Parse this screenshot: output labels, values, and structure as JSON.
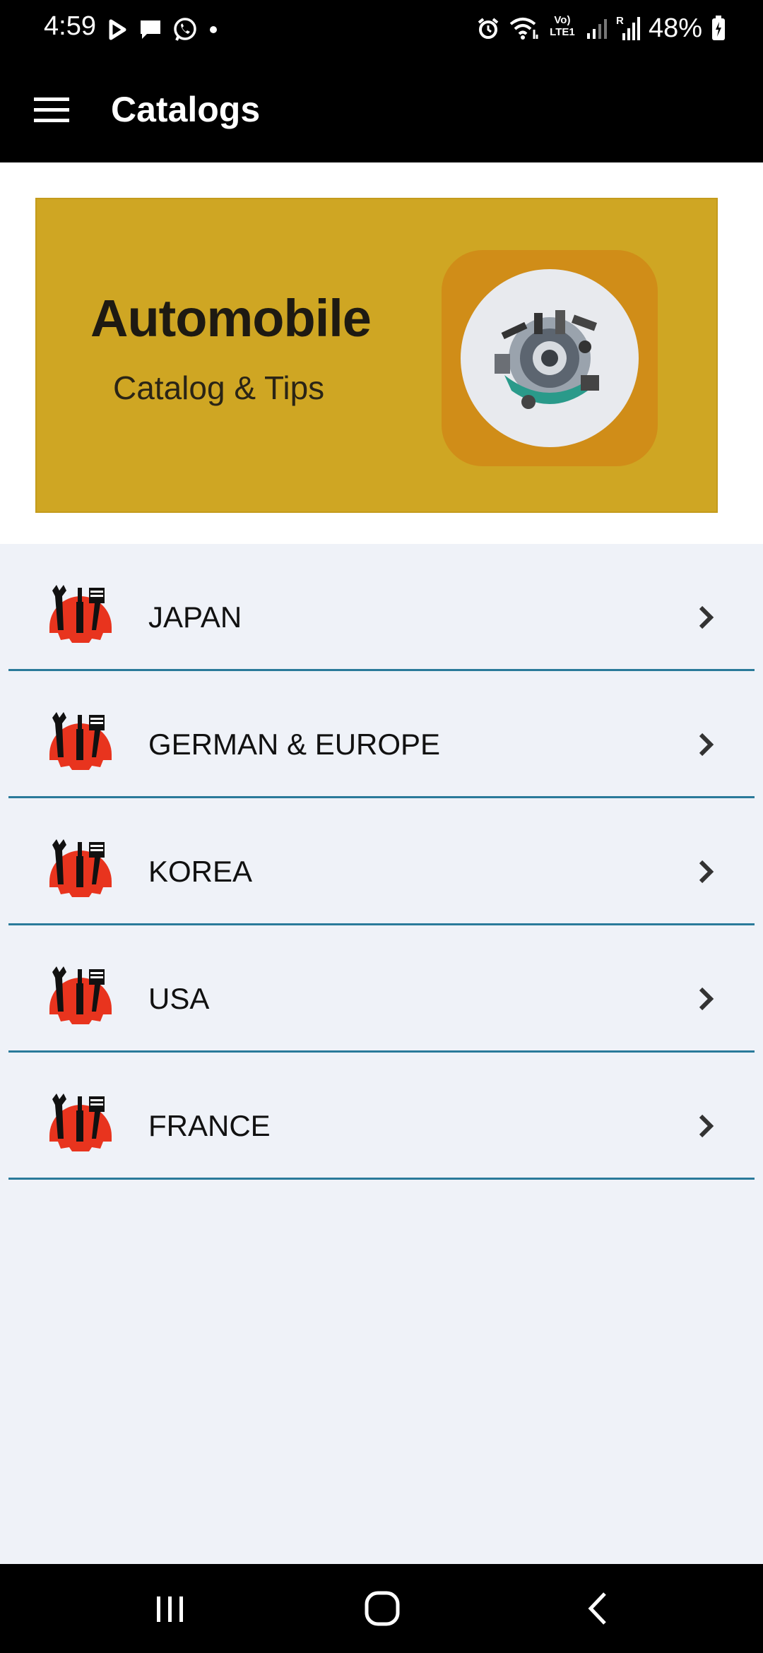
{
  "status_bar": {
    "time": "4:59",
    "battery": "48%",
    "left_icons": [
      "play-icon",
      "message-icon",
      "whatsapp-icon",
      "dot-icon"
    ],
    "right_icons": [
      "alarm-icon",
      "wifi-icon",
      "volte-icon",
      "signal-icon",
      "roaming-signal-icon",
      "battery-charging-icon"
    ],
    "volte_label": "Vo) LTE1",
    "roaming_label": "R"
  },
  "app_bar": {
    "title": "Catalogs",
    "menu_icon": "hamburger-menu-icon"
  },
  "banner": {
    "title": "Automobile",
    "subtitle": "Catalog & Tips",
    "background_color": "#cfa623",
    "logo_color": "#d08d18"
  },
  "catalog_list": {
    "items": [
      {
        "label": "JAPAN"
      },
      {
        "label": "GERMAN & EUROPE"
      },
      {
        "label": "KOREA"
      },
      {
        "label": "USA"
      },
      {
        "label": "FRANCE"
      }
    ],
    "divider_color": "#2a7a9a",
    "icon": "auto-tools-gear-icon",
    "chevron": "chevron-right-icon"
  },
  "nav_bar": {
    "buttons": [
      "recent-apps-icon",
      "home-icon",
      "back-icon"
    ]
  }
}
